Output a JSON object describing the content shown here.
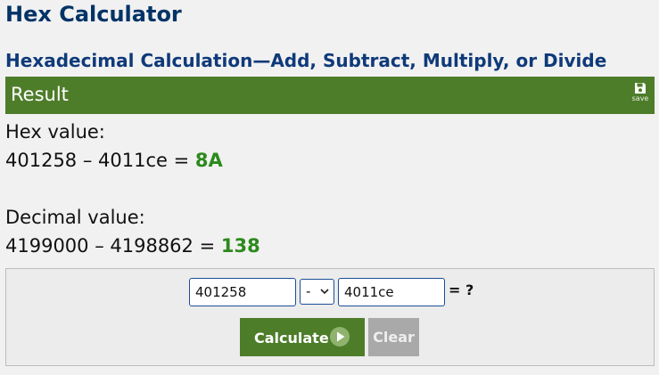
{
  "header": {
    "title": "Hex Calculator",
    "subtitle": "Hexadecimal Calculation—Add, Subtract, Multiply, or Divide"
  },
  "result": {
    "title": "Result",
    "save_label": "save",
    "hex_label": "Hex value:",
    "hex_expression": "401258 – 4011ce =",
    "hex_answer": "8A",
    "decimal_label": "Decimal value:",
    "decimal_expression": "4199000 – 4198862 =",
    "decimal_answer": "138"
  },
  "calculator": {
    "input1_value": "401258",
    "operator_value": "-",
    "input2_value": "4011ce",
    "equals_label": "= ?",
    "calculate_label": "Calculate",
    "clear_label": "Clear"
  },
  "colors": {
    "accent_green": "#4e7d2a",
    "answer_green": "#2b8a1c",
    "title_blue": "#003366"
  }
}
